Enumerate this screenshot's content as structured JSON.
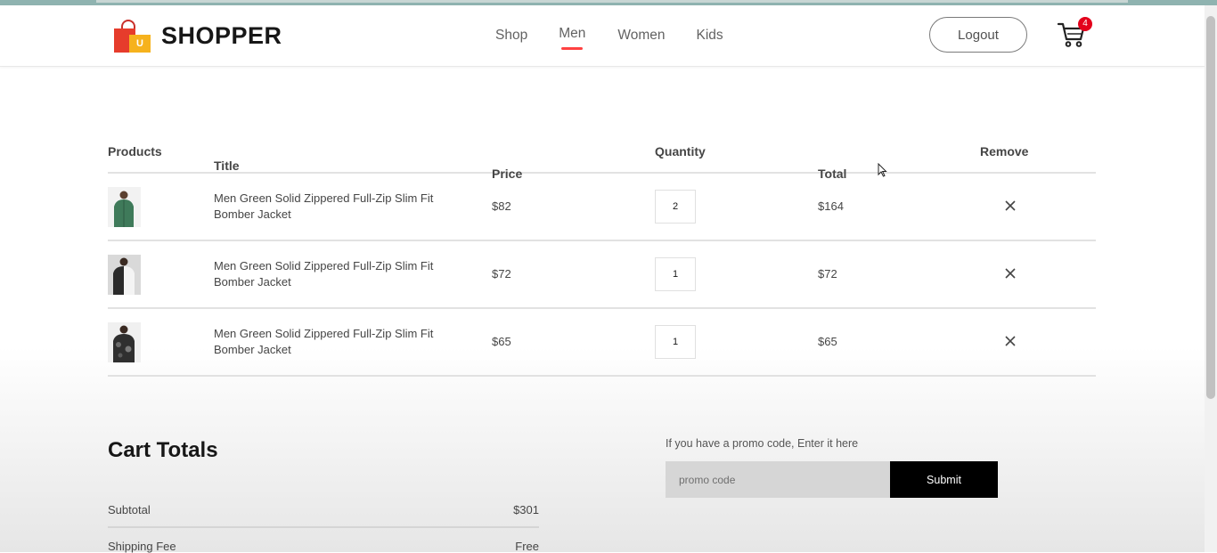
{
  "brand": {
    "name": "SHOPPER",
    "logo_letter": "U"
  },
  "nav": {
    "items": [
      {
        "label": "Shop",
        "active": false
      },
      {
        "label": "Men",
        "active": true
      },
      {
        "label": "Women",
        "active": false
      },
      {
        "label": "Kids",
        "active": false
      }
    ],
    "logout_label": "Logout",
    "cart_count": "4"
  },
  "colors": {
    "accent": "#ff4141",
    "badge": "#e3001b",
    "submit_bg": "#000000"
  },
  "table": {
    "headers": [
      "Products",
      "Title",
      "Price",
      "Quantity",
      "Total",
      "Remove"
    ],
    "rows": [
      {
        "title": "Men Green Solid Zippered Full-Zip Slim Fit Bomber Jacket",
        "price": "$82",
        "quantity": "2",
        "total": "$164"
      },
      {
        "title": "Men Green Solid Zippered Full-Zip Slim Fit Bomber Jacket",
        "price": "$72",
        "quantity": "1",
        "total": "$72"
      },
      {
        "title": "Men Green Solid Zippered Full-Zip Slim Fit Bomber Jacket",
        "price": "$65",
        "quantity": "1",
        "total": "$65"
      }
    ]
  },
  "totals": {
    "heading": "Cart Totals",
    "subtotal_label": "Subtotal",
    "subtotal_value": "$301",
    "shipping_label": "Shipping Fee",
    "shipping_value": "Free"
  },
  "promo": {
    "label": "If you have a promo code, Enter it here",
    "placeholder": "promo code",
    "submit_label": "Submit"
  },
  "icons": {
    "cart": "cart-icon",
    "remove": "close-icon",
    "logo": "shopping-bag-icon"
  }
}
